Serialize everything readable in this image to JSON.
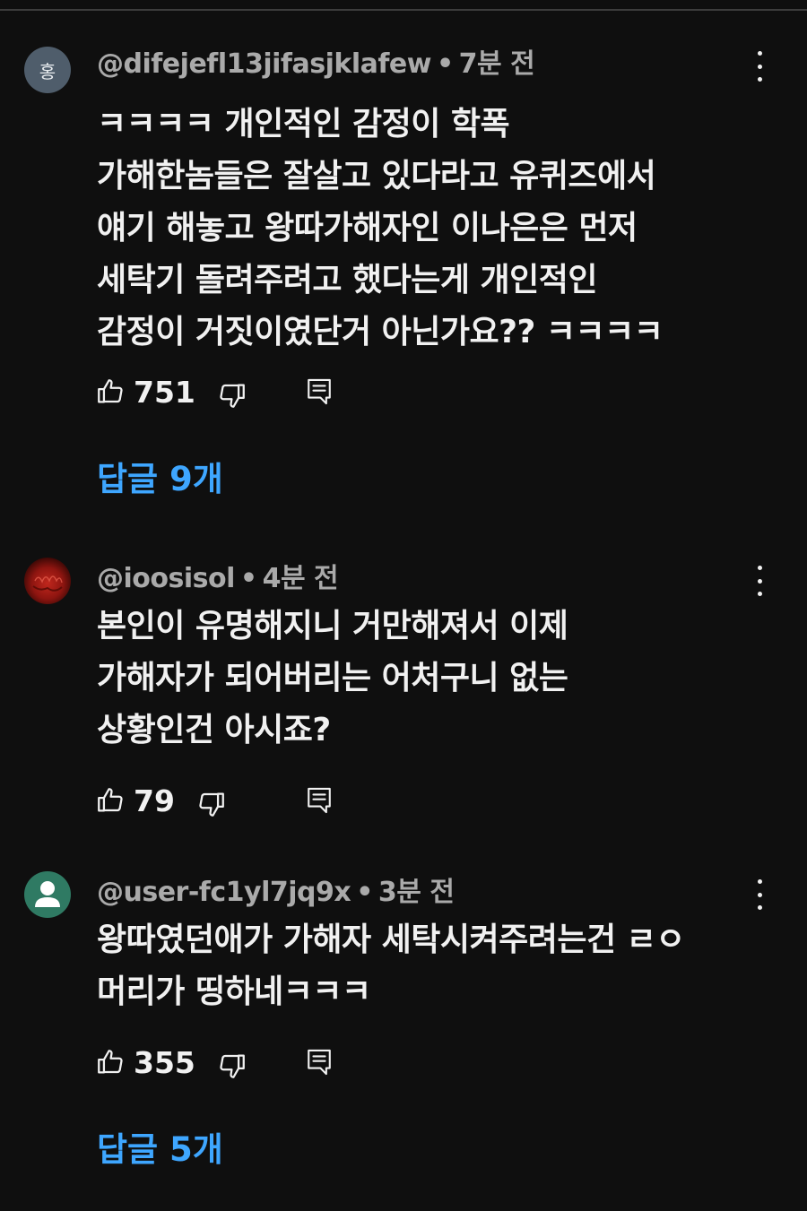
{
  "comments": [
    {
      "avatar_letter": "홍",
      "handle": "@difejefl13jifasjklafew",
      "separator": "•",
      "time": "7분 전",
      "lines": [
        "ㅋㅋㅋㅋ 개인적인 감정이 학폭",
        "가해한놈들은 잘살고 있다라고 유퀴즈에서",
        "얘기 해놓고 왕따가해자인 이나은은 먼저",
        "세탁기 돌려주려고 했다는게 개인적인",
        "감정이 거짓이였단거 아닌가요?? ㅋㅋㅋㅋ"
      ],
      "likes": "751",
      "replies_label": "답글 9개"
    },
    {
      "handle": "@ioosisol",
      "separator": "•",
      "time": "4분 전",
      "lines": [
        "본인이 유명해지니 거만해져서 이제",
        "가해자가 되어버리는 어처구니 없는",
        "상황인건 아시죠?"
      ],
      "likes": "79"
    },
    {
      "handle": "@user-fc1yl7jq9x",
      "separator": "•",
      "time": "3분 전",
      "lines": [
        "왕따였던애가 가해자 세탁시켜주려는건 ㄹㅇ",
        "머리가 띵하네ㅋㅋㅋ"
      ],
      "likes": "355",
      "replies_label": "답글 5개"
    }
  ],
  "icons": {
    "like": "thumbs-up-outline",
    "dislike": "thumbs-down-outline",
    "reply": "comment-outline",
    "more": "vertical-ellipsis"
  },
  "colors": {
    "background": "#0f0f0f",
    "text": "#f1f1f1",
    "meta": "#aaaaaa",
    "link": "#3ea6ff"
  }
}
